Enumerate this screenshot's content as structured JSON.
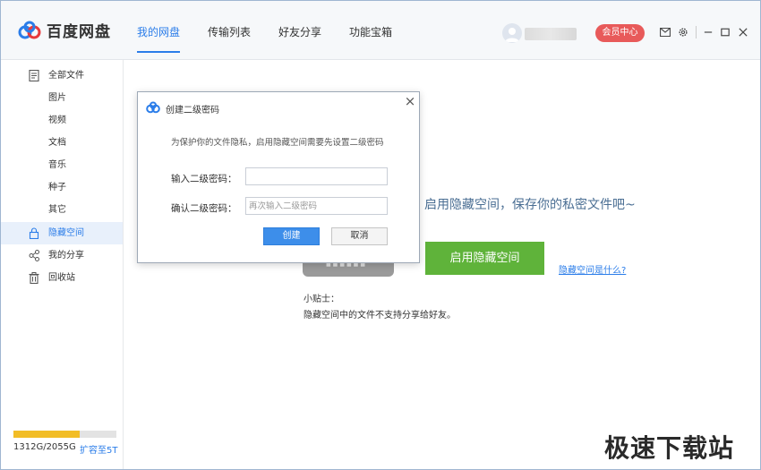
{
  "header": {
    "logo_text": "百度网盘",
    "tabs": [
      {
        "label": "我的网盘",
        "active": true
      },
      {
        "label": "传输列表",
        "active": false
      },
      {
        "label": "好友分享",
        "active": false
      },
      {
        "label": "功能宝箱",
        "active": false
      }
    ],
    "vip_label": "会员中心"
  },
  "sidebar": {
    "items": [
      {
        "label": "全部文件",
        "icon": "file-icon"
      },
      {
        "label": "图片",
        "icon": ""
      },
      {
        "label": "视频",
        "icon": ""
      },
      {
        "label": "文档",
        "icon": ""
      },
      {
        "label": "音乐",
        "icon": ""
      },
      {
        "label": "种子",
        "icon": ""
      },
      {
        "label": "其它",
        "icon": ""
      },
      {
        "label": "隐藏空间",
        "icon": "lock-icon",
        "active": true
      },
      {
        "label": "我的分享",
        "icon": "share-icon"
      },
      {
        "label": "回收站",
        "icon": "trash-icon"
      }
    ],
    "storage_text": "1312G/2055G",
    "storage_used_fraction": 0.64,
    "expand_label": "扩容至5T"
  },
  "main": {
    "slogan": "启用隐藏空间，保存你的私密文件吧~",
    "enable_button": "启用隐藏空间",
    "what_link": "隐藏空间是什么?",
    "tip_title": "小贴士：",
    "tip_text": "隐藏空间中的文件不支持分享给好友。"
  },
  "dialog": {
    "title": "创建二级密码",
    "description": "为保护你的文件隐私，启用隐藏空间需要先设置二级密码",
    "password_label": "输入二级密码：",
    "password_value": "",
    "confirm_label": "确认二级密码：",
    "confirm_placeholder": "再次输入二级密码",
    "create_button": "创建",
    "cancel_button": "取消"
  },
  "colors": {
    "accent": "#2b7de9",
    "vip": "#e85a5a",
    "enable": "#5fb33a",
    "storage": "#f2bd26"
  },
  "watermark": "极速下载站"
}
